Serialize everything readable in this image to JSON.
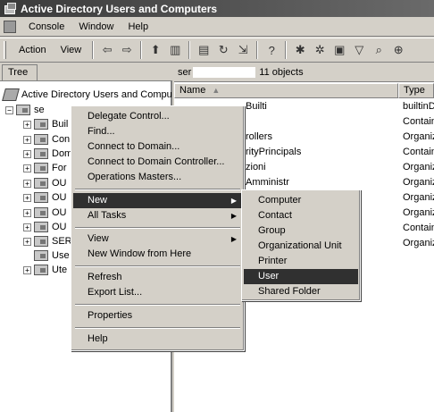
{
  "window": {
    "title": "Active Directory Users and Computers"
  },
  "menubar": {
    "items": [
      "Console",
      "Window",
      "Help"
    ]
  },
  "toolbar": {
    "action_label": "Action",
    "view_label": "View"
  },
  "tree": {
    "tab_label": "Tree",
    "root_label": "Active Directory Users and Compu",
    "domain_label": "se",
    "items": [
      "Buil",
      "Con",
      "Dom",
      "For",
      "OU",
      "OU",
      "OU",
      "OU",
      "SER",
      "Use",
      "Ute"
    ]
  },
  "list": {
    "domain_prefix": "ser",
    "object_count": "11 objects",
    "columns": {
      "name": "Name",
      "type": "Type"
    },
    "rows": [
      {
        "name": "Builti",
        "type": "builtinD"
      },
      {
        "name": "",
        "type": "Contain"
      },
      {
        "name": "rollers",
        "type": "Organiz"
      },
      {
        "name": "rityPrincipals",
        "type": "Contain"
      },
      {
        "name": "zioni",
        "type": "Organiz"
      },
      {
        "name": "Amministr",
        "type": "Organiz"
      },
      {
        "name": "",
        "type": "Organiz"
      },
      {
        "name": "",
        "type": "Organiz"
      },
      {
        "name": "",
        "type": "Contain"
      },
      {
        "name": "",
        "type": "Organiz"
      }
    ]
  },
  "context_menu": {
    "items": {
      "delegate": "Delegate Control...",
      "find": "Find...",
      "connect_domain": "Connect to Domain...",
      "connect_dc": "Connect to Domain Controller...",
      "operations": "Operations Masters...",
      "new": "New",
      "all_tasks": "All Tasks",
      "view": "View",
      "new_window": "New Window from Here",
      "refresh": "Refresh",
      "export": "Export List...",
      "properties": "Properties",
      "help": "Help"
    }
  },
  "submenu": {
    "items": [
      "Computer",
      "Contact",
      "Group",
      "Organizational Unit",
      "Printer",
      "User",
      "Shared Folder"
    ],
    "selected": "User"
  }
}
